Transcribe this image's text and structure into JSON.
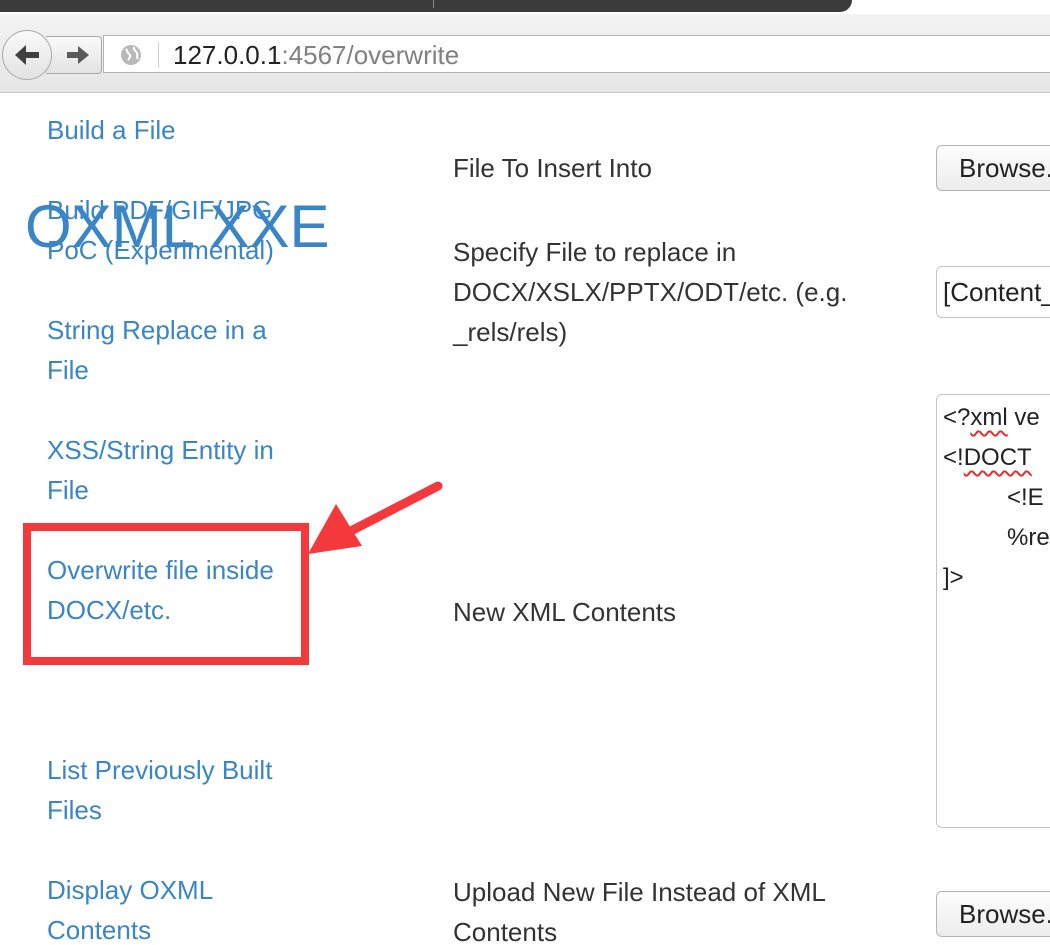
{
  "browser": {
    "back_icon": "left-arrow-icon",
    "forward_icon": "right-arrow-icon",
    "site_icon": "globe-icon",
    "url_host": "127.0.0.1",
    "url_rest": ":4567/overwrite"
  },
  "page": {
    "heading": "OXML XXE"
  },
  "sidebar": {
    "items": [
      {
        "label": "Build a File"
      },
      {
        "label": "Build PDF/GIF/JPG PoC (Experimental)"
      },
      {
        "label": "String Replace in a File"
      },
      {
        "label": "XSS/String Entity in File"
      },
      {
        "label": "Overwrite file inside DOCX/etc."
      },
      {
        "label": "List Previously Built Files"
      },
      {
        "label": "Display OXML Contents"
      }
    ]
  },
  "form": {
    "file_to_insert_label": "File To Insert Into",
    "file_to_insert_button": "Browse...",
    "specify_file_label": "Specify File to replace in DOCX/XSLX/PPTX/ODT/etc. (e.g. _rels/rels)",
    "specify_file_value": "[Content_Types].xml",
    "new_xml_label": "New XML Contents",
    "new_xml_lines": {
      "line1_prefix": "<?",
      "line1_word": "xml",
      "line1_rest": " ve",
      "line2_prefix": "<!",
      "line2_word": "DOCT",
      "line3": "<!E",
      "line4": "%re",
      "line5": "]>"
    },
    "upload_label": "Upload New File Instead of XML Contents",
    "upload_button": "Browse..."
  },
  "annotation": {
    "color": "#f4393c",
    "highlighted_item": "Overwrite file inside DOCX/etc."
  }
}
